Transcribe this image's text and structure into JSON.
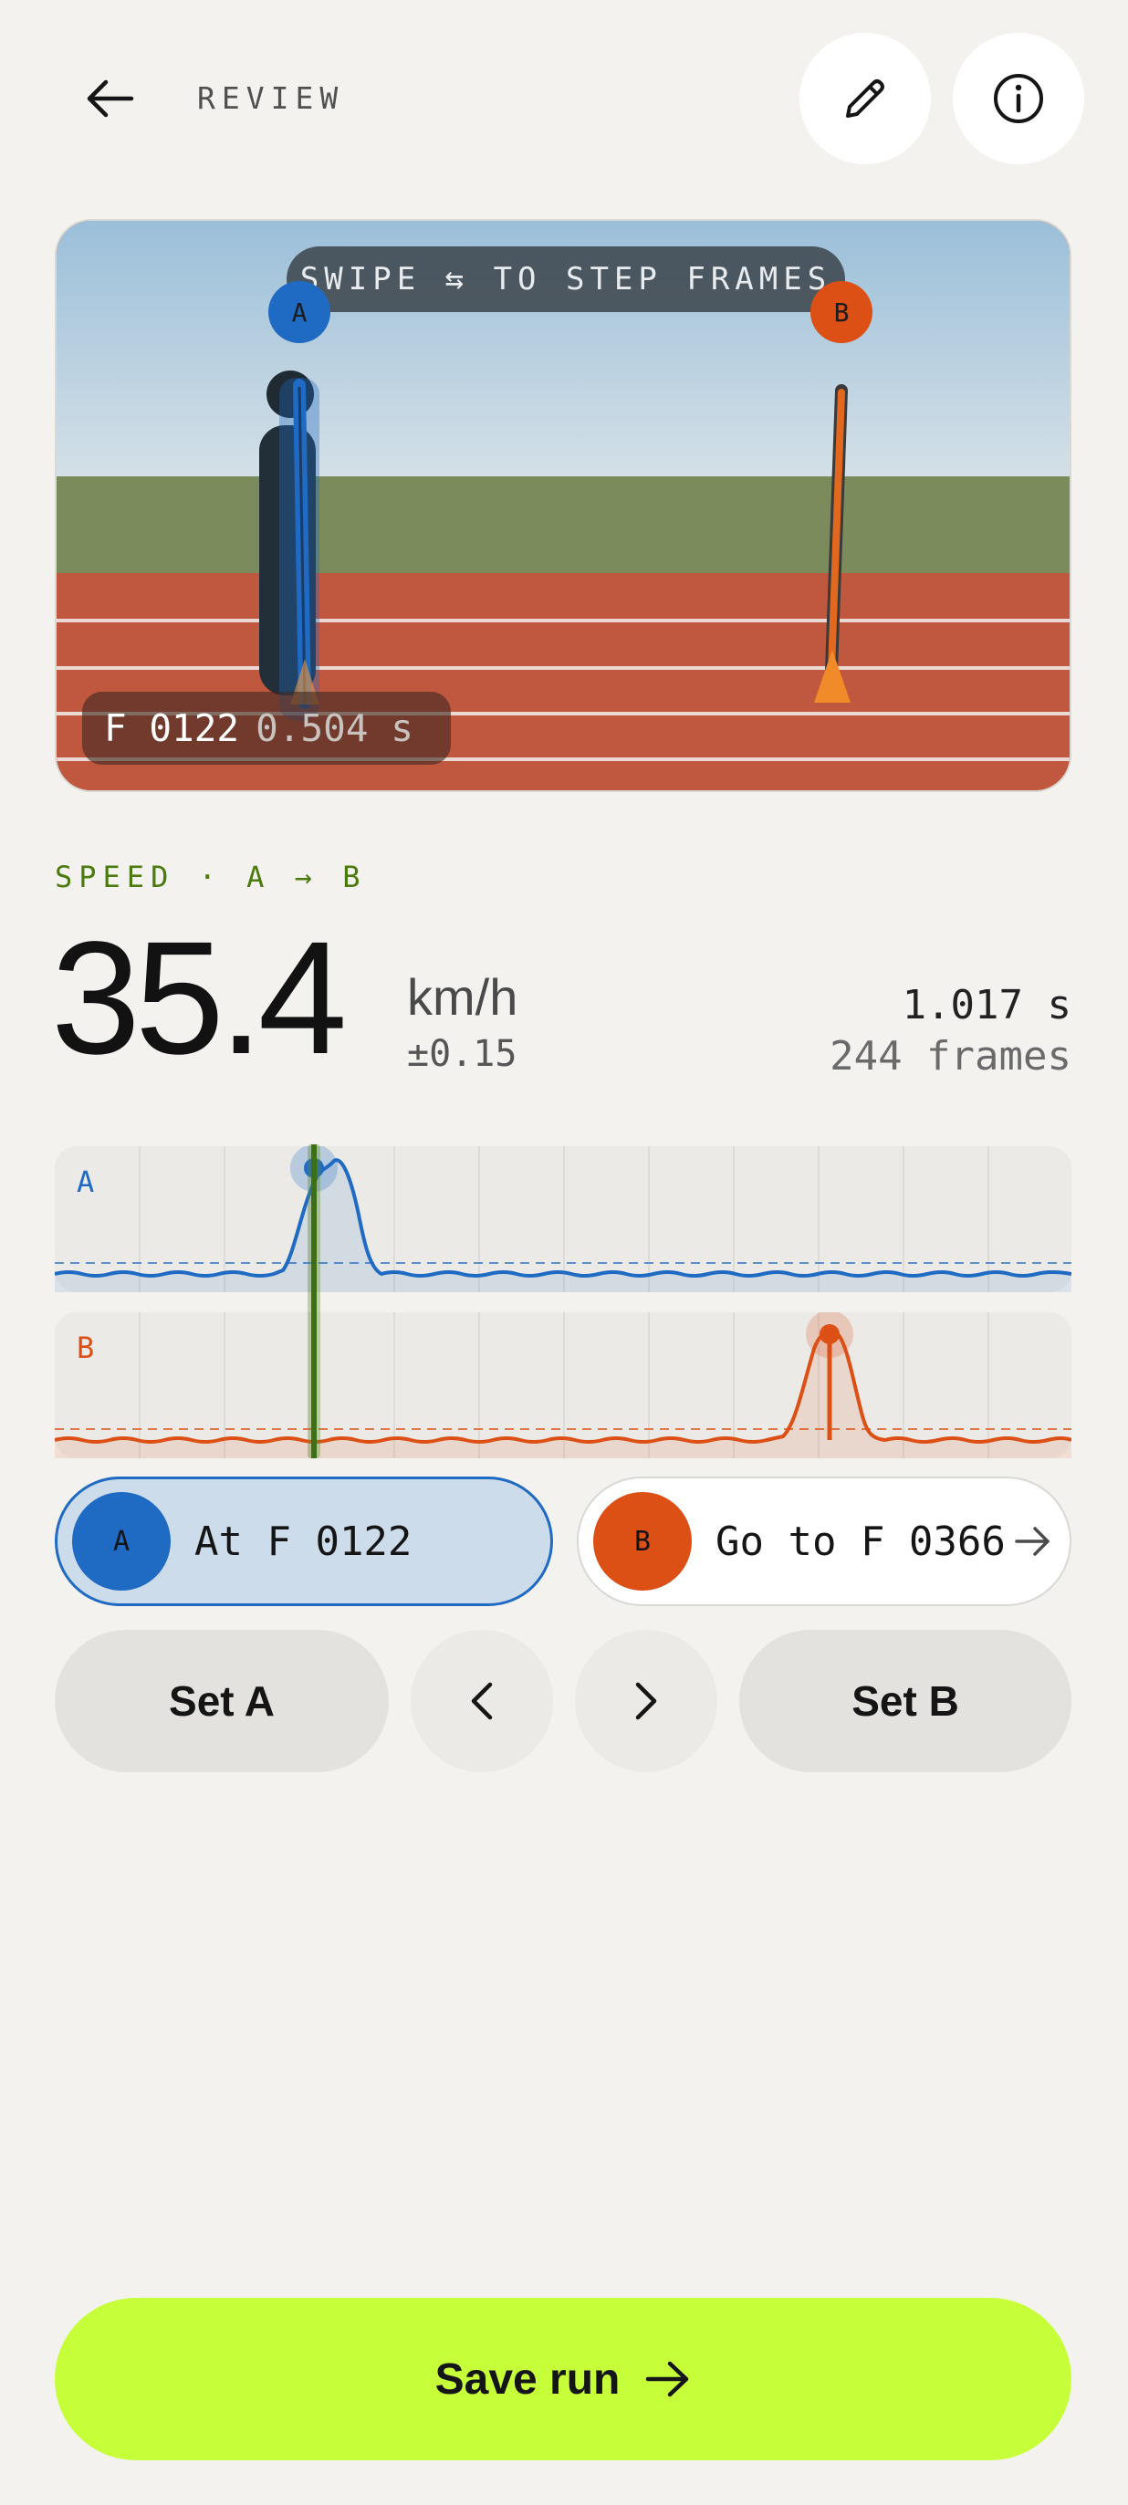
{
  "header": {
    "title": "REVIEW",
    "back_icon": "arrow-left-icon",
    "edit_icon": "pencil-icon",
    "info_icon": "info-icon"
  },
  "viewer": {
    "hint": "SWIPE ⇆ TO STEP FRAMES",
    "frame_label": "F 0122",
    "frame_time": "0.504 s",
    "marker_a": "A",
    "marker_b": "B"
  },
  "speed": {
    "label": "SPEED · A → B",
    "value": "35.4",
    "unit": "km/h",
    "uncertainty": "±0.15",
    "duration": "1.017 s",
    "frames": "244 frames"
  },
  "traces": {
    "a_label": "A",
    "b_label": "B"
  },
  "markers": {
    "a_letter": "A",
    "a_text": "At F 0122",
    "b_letter": "B",
    "b_text": "Go to F 0366"
  },
  "controls": {
    "set_a": "Set A",
    "set_b": "Set B",
    "prev_icon": "chevron-left-icon",
    "next_icon": "chevron-right-icon"
  },
  "save": {
    "label": "Save run",
    "icon": "arrow-right-icon"
  },
  "colors": {
    "marker_a": "#1f6ac3",
    "marker_b": "#dc4f15",
    "accent": "#c6ff3a",
    "speed_label": "#4b7a0f"
  }
}
